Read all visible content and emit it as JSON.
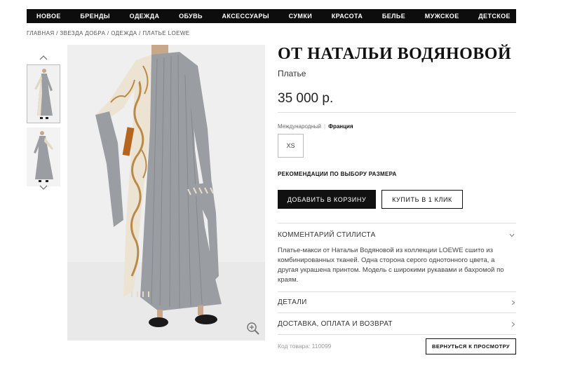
{
  "nav": {
    "items": [
      "НОВОЕ",
      "БРЕНДЫ",
      "ОДЕЖДА",
      "ОБУВЬ",
      "АКСЕССУАРЫ",
      "СУМКИ",
      "КРАСОТА",
      "БЕЛЬЕ",
      "МУЖСКОЕ",
      "ДЕТСКОЕ"
    ]
  },
  "breadcrumb": "ГЛАВНАЯ / ЗВЕЗДА ДОБРА / ОДЕЖДА / ПЛАТЬЕ LOEWE",
  "gallery": {
    "up_icon": "chevron-up-icon",
    "down_icon": "chevron-down-icon",
    "zoom_icon": "zoom-in-icon"
  },
  "product": {
    "title": "ОТ НАТАЛЬИ ВОДЯНОВОЙ",
    "type": "Платье",
    "price": "35 000 р."
  },
  "sizes": {
    "tab_international": "Международный",
    "tab_france": "Франция",
    "options": [
      "XS"
    ],
    "guide": "РЕКОМЕНДАЦИИ ПО ВЫБОРУ РАЗМЕРА"
  },
  "actions": {
    "add_to_cart": "ДОБАВИТЬ В КОРЗИНУ",
    "buy_one_click": "КУПИТЬ В 1 КЛИК"
  },
  "accordion": {
    "stylist_title": "КОММЕНТАРИЙ СТИЛИСТА",
    "stylist_text": "Платье-макси от Натальи Водяновой из коллекции LOEWE сшито из комбинированных тканей. Одна сторона серого однотонного цвета, а другая украшена принтом. Модель с широкими рукавами и бахромой по краям.",
    "details_title": "ДЕТАЛИ",
    "delivery_title": "ДОСТАВКА, ОПЛАТА И ВОЗВРАТ"
  },
  "footer": {
    "product_code": "Код товара: 110099",
    "back_button": "ВЕРНУТЬСЯ К ПРОСМОТРУ"
  },
  "colors": {
    "nav_bg": "#0d0d0d",
    "dress_gray": "#9a9ea3",
    "print_gold": "#b98a4a"
  }
}
